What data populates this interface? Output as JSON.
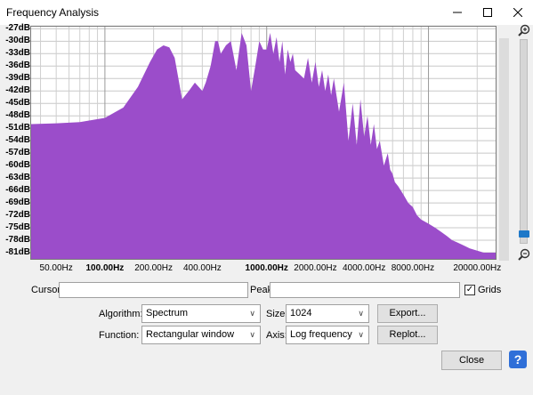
{
  "window": {
    "title": "Frequency Analysis"
  },
  "y_axis_labels": [
    "-27dB",
    "-30dB",
    "-33dB",
    "-36dB",
    "-39dB",
    "-42dB",
    "-45dB",
    "-48dB",
    "-51dB",
    "-54dB",
    "-57dB",
    "-60dB",
    "-63dB",
    "-66dB",
    "-69dB",
    "-72dB",
    "-75dB",
    "-78dB",
    "-81dB"
  ],
  "x_axis_labels": [
    "50.00Hz",
    "100.00Hz",
    "200.00Hz",
    "400.00Hz",
    "1000.00Hz",
    "2000.00Hz",
    "4000.00Hz",
    "8000.00Hz",
    "20000.00Hz"
  ],
  "controls": {
    "cursor_label": "Cursor:",
    "cursor_value": "",
    "peak_label": "Peak:",
    "peak_value": "",
    "grids_label": "Grids",
    "grids_checked": true,
    "algorithm_label": "Algorithm:",
    "algorithm_value": "Spectrum",
    "size_label": "Size:",
    "size_value": "1024",
    "export_label": "Export...",
    "function_label": "Function:",
    "function_value": "Rectangular window",
    "axis_label": "Axis:",
    "axis_value": "Log frequency",
    "replot_label": "Replot...",
    "close_label": "Close",
    "help_label": "?"
  },
  "chart_data": {
    "type": "area",
    "xscale": "log",
    "xlim": [
      35,
      26000
    ],
    "ylim": [
      -82.5,
      -26.5
    ],
    "grid": true,
    "color": "#9b4dca",
    "series": [
      {
        "x": [
          35,
          50,
          70,
          100,
          130,
          160,
          190,
          210,
          230,
          250,
          270,
          300,
          330,
          360,
          380,
          400,
          420,
          450,
          480,
          500,
          520,
          560,
          600,
          650,
          700,
          750,
          800,
          850,
          900,
          950,
          1000,
          1050,
          1100,
          1150,
          1200,
          1250,
          1300,
          1350,
          1400,
          1450,
          1500,
          1600,
          1700,
          1800,
          1900,
          2000,
          2100,
          2200,
          2300,
          2400,
          2500,
          2600,
          2800,
          3000,
          3200,
          3400,
          3600,
          3800,
          4000,
          4200,
          4400,
          4600,
          4800,
          5000,
          5300,
          5600,
          5800,
          6000,
          6200,
          6500,
          7000,
          7500,
          8000,
          8500,
          9000,
          10000,
          11000,
          12000,
          13000,
          14000,
          15000,
          16000,
          17000,
          18000,
          20000,
          22000,
          24000,
          26000
        ],
        "y": [
          -50,
          -49.8,
          -49.5,
          -48.5,
          -46,
          -41,
          -35,
          -32,
          -31,
          -31.5,
          -34,
          -44,
          -42,
          -40,
          -41,
          -42,
          -40,
          -36,
          -30,
          -30,
          -33,
          -31,
          -30,
          -37,
          -28,
          -31,
          -42,
          -36,
          -30,
          -32,
          -32,
          -28,
          -33,
          -29,
          -35,
          -30,
          -38,
          -32,
          -35,
          -33,
          -37,
          -38,
          -39,
          -34,
          -40,
          -35,
          -41,
          -37,
          -42,
          -38,
          -43,
          -39,
          -47,
          -40,
          -54,
          -45,
          -55,
          -44,
          -53,
          -48,
          -55,
          -50,
          -56,
          -54,
          -60,
          -57,
          -61,
          -62,
          -64,
          -65,
          -67,
          -69,
          -70,
          -72,
          -73,
          -74,
          -75,
          -76,
          -77,
          -78,
          -78.5,
          -79,
          -79.5,
          -80,
          -80.5,
          -81,
          -81,
          -81
        ]
      }
    ]
  }
}
